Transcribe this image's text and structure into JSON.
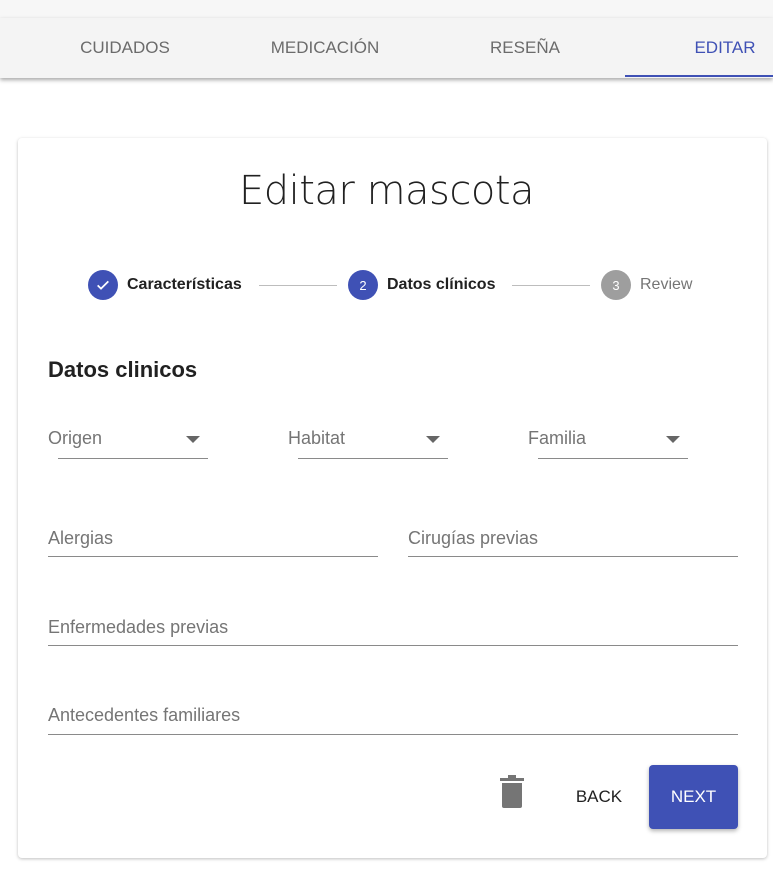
{
  "tabs": [
    {
      "label": "CUIDADOS"
    },
    {
      "label": "MEDICACIÓN"
    },
    {
      "label": "RESEÑA"
    },
    {
      "label": "EDITAR"
    }
  ],
  "title": "Editar mascota",
  "stepper": {
    "steps": [
      {
        "num": "✓",
        "label": "Características"
      },
      {
        "num": "2",
        "label": "Datos clínicos"
      },
      {
        "num": "3",
        "label": "Review"
      }
    ]
  },
  "section_title": "Datos clinicos",
  "fields": {
    "origen": "Origen",
    "habitat": "Habitat",
    "familia": "Familia",
    "alergias": "Alergias",
    "cirugias": "Cirugías previas",
    "enfermedades": "Enfermedades previas",
    "antecedentes": "Antecedentes familiares"
  },
  "actions": {
    "back": "BACK",
    "next": "NEXT"
  },
  "colors": {
    "primary": "#3f51b5",
    "inactive_step": "#9e9e9e"
  }
}
